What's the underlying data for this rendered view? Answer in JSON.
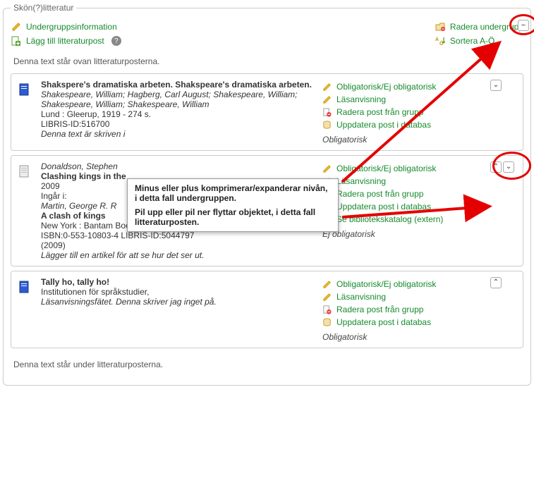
{
  "group": {
    "legend": "Skön(?)litteratur",
    "subgroup_info": "Undergruppsinformation",
    "add_lit": "Lägg till litteraturpost",
    "delete_subgroup": "Radera undergrupp",
    "sort": "Sortera A-Ö",
    "intro": "Denna text står ovan litteraturposterna.",
    "outro": "Denna text står under litteraturposterna."
  },
  "action_labels": {
    "mandatory": "Obligatorisk/Ej obligatorisk",
    "reading": "Läsanvisning",
    "remove": "Radera post från grupp",
    "update": "Uppdatera post i databas",
    "catalog": "Se bibliotekskatalog (extern)",
    "status_mandatory": "Obligatorisk",
    "status_not_mandatory": "Ej obligatorisk"
  },
  "tooltip": {
    "p1": "Minus eller plus komprimerar/expanderar nivån, i detta fall undergruppen.",
    "p2": "Pil upp eller pil ner flyttar objektet, i detta fall litteraturposten."
  },
  "entries": [
    {
      "icon": "blue",
      "title": "Shakspere's dramatiska arbeten. Shakspeare's dramatiska arbeten.",
      "authors": "Shakespeare, William; Hagberg, Carl August; Shakespeare, William; Shakespeare, William; Shakespeare, William",
      "pub": "Lund : Gleerup, 1919 - 274 s.",
      "ids": "LIBRIS-ID:516700",
      "note": "Denna text är skriven i",
      "status": "Obligatorisk",
      "actions": [
        "mandatory",
        "reading",
        "remove",
        "update"
      ],
      "move": [
        "down"
      ]
    },
    {
      "icon": "grey",
      "author_top": "Donaldson, Stephen",
      "title": "Clashing kings in the",
      "year": "2009",
      "inpart": "Ingår i:",
      "author2": "Martin, George R. R",
      "title2": "A clash of kings",
      "pub": "New York : Bantam Books, 1999 - 761 p.",
      "ids": "ISBN:0-553-10803-4  LIBRIS-ID:5044797",
      "year2": "(2009)",
      "note": "Lägger till en artikel för att se hur det ser ut.",
      "status": "Ej obligatorisk",
      "actions": [
        "mandatory",
        "reading",
        "remove",
        "update",
        "catalog"
      ],
      "move": [
        "up",
        "down"
      ]
    },
    {
      "icon": "blue",
      "title": "Tally ho, tally ho!",
      "authors_plain": "Institutionen för språkstudier,",
      "note": "Läsanvisningsfätet. Denna skriver jag inget på.",
      "status": "Obligatorisk",
      "actions": [
        "mandatory",
        "reading",
        "remove",
        "update"
      ],
      "move": [
        "up"
      ]
    }
  ]
}
